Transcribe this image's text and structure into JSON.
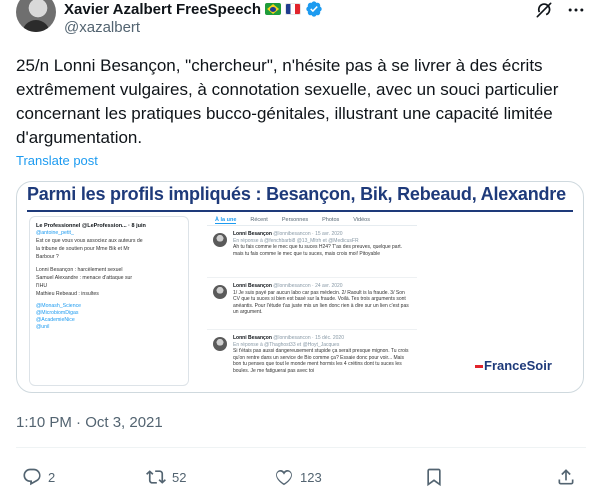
{
  "author": {
    "display_name": "Xavier Azalbert FreeSpeech",
    "handle": "@xazalbert",
    "flags": [
      "brazil-flag-icon",
      "france-flag-icon"
    ],
    "verified": true
  },
  "header_icons": [
    "grok-icon",
    "more-icon"
  ],
  "tweet": {
    "text": "25/n Lonni Besançon, \"chercheur\", n'hésite pas à se livrer à des écrits extrêmement vulgaires, à connotation sexuelle, avec un souci particulier concernant les pratiques bucco-génitales, illustrant une capacité limitée d'argumentation.",
    "translate_label": "Translate post"
  },
  "media": {
    "title": "Parmi les profils impliqués : Besançon, Bik, Rebeaud, Alexandre",
    "left_card": {
      "head": "Le Professionnel @LeProfession... · 8 juin",
      "mention": "@antoine_petit_",
      "body": [
        "Est ce que vous vous associez aux auteurs de",
        "la tribune de soutien pour Mme Bik et Mr",
        "Barbour ?"
      ],
      "list": [
        "Lonni Besançon : harcèlement sexuel",
        "Samuel Alexandre : menace d'attaque sur",
        "l'IHU",
        "Mathieu Rebeaud : insultes"
      ],
      "tags": [
        "@Monash_Science",
        "@MicrobiomDigas",
        "@AcademieNice",
        "@unil"
      ]
    },
    "tabs": [
      "À la une",
      "Récent",
      "Personnes",
      "Photos",
      "Vidéos"
    ],
    "mini_tweets": [
      {
        "name": "Lonni Besançon",
        "meta": "@lonnibesancon · 15 avr. 2020",
        "reply": "En réponse à @fenchbarbi8 @13_Mltrh et @MedicusFR",
        "body": "Ah tu fais comme le mec que tu suces H24? T'as des preuves, quelque part. mais tu fais comme le mec que tu suces, mais crois moi! Pitoyable"
      },
      {
        "name": "Lonni Besançon",
        "meta": "@lonnibesancon · 24 avr. 2020",
        "reply": "",
        "body": "1/ Je suis payé par aucun labo car pas médecin. 2/ Raoult is la fraude. 3/ Son CV que tu suces si bien est basé sur la fraude. Voilà. Tes trois arguments sont anéantis. Pour l'étude t'as juste mis un lien donc rien à dire sur un lien c'est pas un argument."
      },
      {
        "name": "Lonni Besançon",
        "meta": "@lonnibesancon · 15 déc. 2020",
        "reply": "En réponse à @Thaghost33 et @Hoyt_Jacques",
        "body": "Si t'étais pas aussi dangereusement stupide ça serait presque mignon. Tu crois qu'on rentre dans un service de Bio comme ça? Essaie donc pour voir... Mais bon tu penses que tout le monde ment hormis les 4 crétins dont tu suces les boules. Je me fatiguerai pas avec toi"
      }
    ],
    "watermark": "FranceSoir"
  },
  "timestamp": "1:10 PM · Oct 3, 2021",
  "actions": {
    "reply_count": "2",
    "retweet_count": "52",
    "like_count": "123"
  },
  "colors": {
    "link": "#1d9bf0",
    "verified": "#1d9bf0",
    "text_secondary": "#536471",
    "title_navy": "#1e3a7a",
    "accent_red": "#e1242c"
  }
}
